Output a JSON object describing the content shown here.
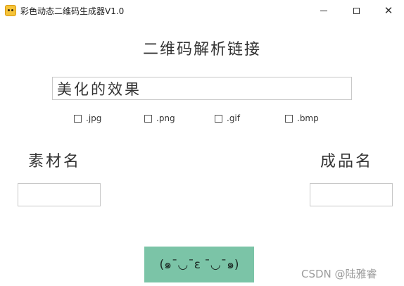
{
  "window": {
    "title": "彩色动态二维码生成器V1.0",
    "icon": "pikachu-app-icon",
    "controls": {
      "minimize": "minimize-icon",
      "maximize": "maximize-icon",
      "close": "✕"
    }
  },
  "main": {
    "heading": "二维码解析链接",
    "content_input": {
      "value": "美化的效果",
      "placeholder": ""
    },
    "formats": [
      {
        "label": ".jpg",
        "checked": false
      },
      {
        "label": ".png",
        "checked": false
      },
      {
        "label": ".gif",
        "checked": false
      },
      {
        "label": ".bmp",
        "checked": false
      }
    ],
    "source_label": "素材名",
    "output_label": "成品名",
    "source_field": {
      "value": ""
    },
    "output_field": {
      "value": ""
    },
    "action_button_label": "(๑¯◡¯ε ¯◡¯๑)"
  },
  "watermark": "CSDN @陆雅睿",
  "colors": {
    "button_bg": "#7bc4a7",
    "background": "#ffffff"
  }
}
